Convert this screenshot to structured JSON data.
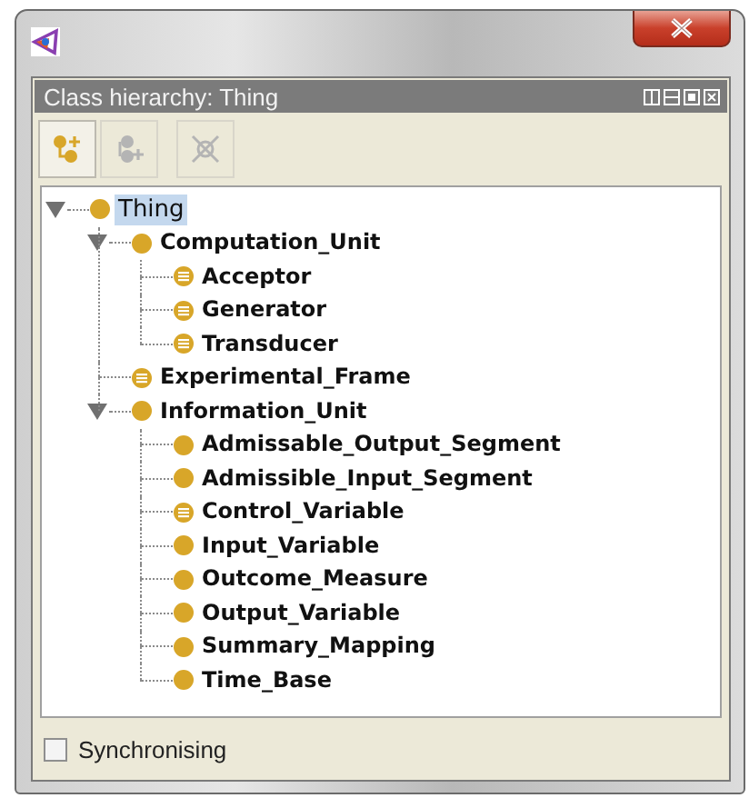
{
  "panel": {
    "title": "Class hierarchy: Thing"
  },
  "toolbar": [
    {
      "kind": "add-subclass",
      "disabled": false
    },
    {
      "kind": "add-sibling",
      "disabled": true
    },
    {
      "kind": "delete",
      "disabled": true
    }
  ],
  "tree": [
    {
      "label": "Thing",
      "kind": "class",
      "selected": true,
      "expanded": true,
      "children": [
        {
          "label": "Computation_Unit",
          "kind": "class",
          "selected": false,
          "expanded": true,
          "children": [
            {
              "label": "Acceptor",
              "kind": "defined",
              "selected": false
            },
            {
              "label": "Generator",
              "kind": "defined",
              "selected": false
            },
            {
              "label": "Transducer",
              "kind": "defined",
              "selected": false
            }
          ]
        },
        {
          "label": "Experimental_Frame",
          "kind": "defined",
          "selected": false
        },
        {
          "label": "Information_Unit",
          "kind": "class",
          "selected": false,
          "expanded": true,
          "children": [
            {
              "label": "Admissable_Output_Segment",
              "kind": "class",
              "selected": false
            },
            {
              "label": "Admissible_Input_Segment",
              "kind": "class",
              "selected": false
            },
            {
              "label": "Control_Variable",
              "kind": "defined",
              "selected": false
            },
            {
              "label": "Input_Variable",
              "kind": "class",
              "selected": false
            },
            {
              "label": "Outcome_Measure",
              "kind": "class",
              "selected": false
            },
            {
              "label": "Output_Variable",
              "kind": "class",
              "selected": false
            },
            {
              "label": "Summary_Mapping",
              "kind": "class",
              "selected": false
            },
            {
              "label": "Time_Base",
              "kind": "class",
              "selected": false
            }
          ]
        }
      ]
    }
  ],
  "synchronising": {
    "label": "Synchronising",
    "checked": false
  }
}
